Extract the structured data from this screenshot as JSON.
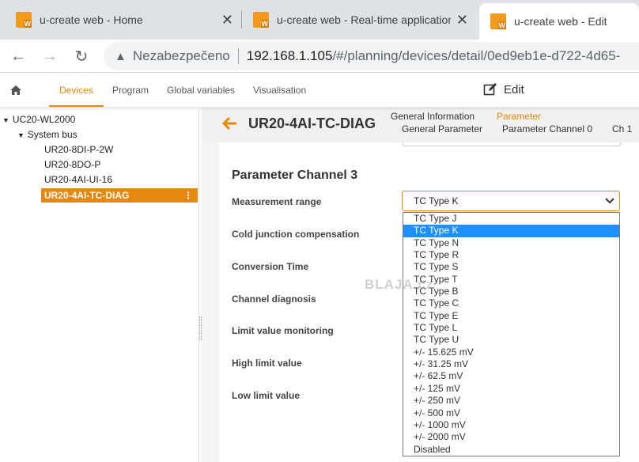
{
  "browser": {
    "tabs": [
      {
        "title": "u-create web - Home",
        "active": false
      },
      {
        "title": "u-create web - Real-time application",
        "active": false
      },
      {
        "title": "u-create web - Edit",
        "active": true
      }
    ],
    "address": {
      "security": "Nezabezpečeno",
      "host": "192.168.1.105",
      "path": "/#/planning/devices/detail/0ed9eb1e-d722-4d65-"
    }
  },
  "app": {
    "nav": {
      "devices": "Devices",
      "program": "Program",
      "global_variables": "Global variables",
      "visualisation": "Visualisation"
    },
    "edit_label": "Edit",
    "accent": "#e8870e"
  },
  "tree": {
    "root": "UC20-WL2000",
    "bus": "System bus",
    "modules": [
      "UR20-8DI-P-2W",
      "UR20-8DO-P",
      "UR20-4AI-UI-16"
    ],
    "selected": "UR20-4AI-TC-DIAG"
  },
  "detail": {
    "title": "UR20-4AI-TC-DIAG",
    "tabs_top": {
      "general_information": "General Information",
      "parameter": "Parameter"
    },
    "tabs_sub": {
      "general_parameter": "General Parameter",
      "channel0": "Parameter Channel 0",
      "ch1": "Ch 1"
    },
    "section_title": "Parameter Channel 3",
    "labels": {
      "measurement_range": "Measurement range",
      "cold_junction": "Cold junction compensation",
      "conversion_time": "Conversion Time",
      "channel_diagnosis": "Channel diagnosis",
      "limit_monitoring": "Limit value monitoring",
      "high_limit": "High limit value",
      "low_limit": "Low limit value"
    },
    "measurement_range_value": "TC Type K",
    "options": [
      "TC Type J",
      "TC Type K",
      "TC Type N",
      "TC Type R",
      "TC Type S",
      "TC Type T",
      "TC Type B",
      "TC Type C",
      "TC Type E",
      "TC Type L",
      "TC Type U",
      "+/- 15.625 mV",
      "+/- 31.25 mV",
      "+/- 62.5 mV",
      "+/- 125 mV",
      "+/- 250 mV",
      "+/- 500 mV",
      "+/- 1000 mV",
      "+/- 2000 mV",
      "Disabled"
    ],
    "selected_option_index": 1
  },
  "watermark": "BLAJA.cz"
}
